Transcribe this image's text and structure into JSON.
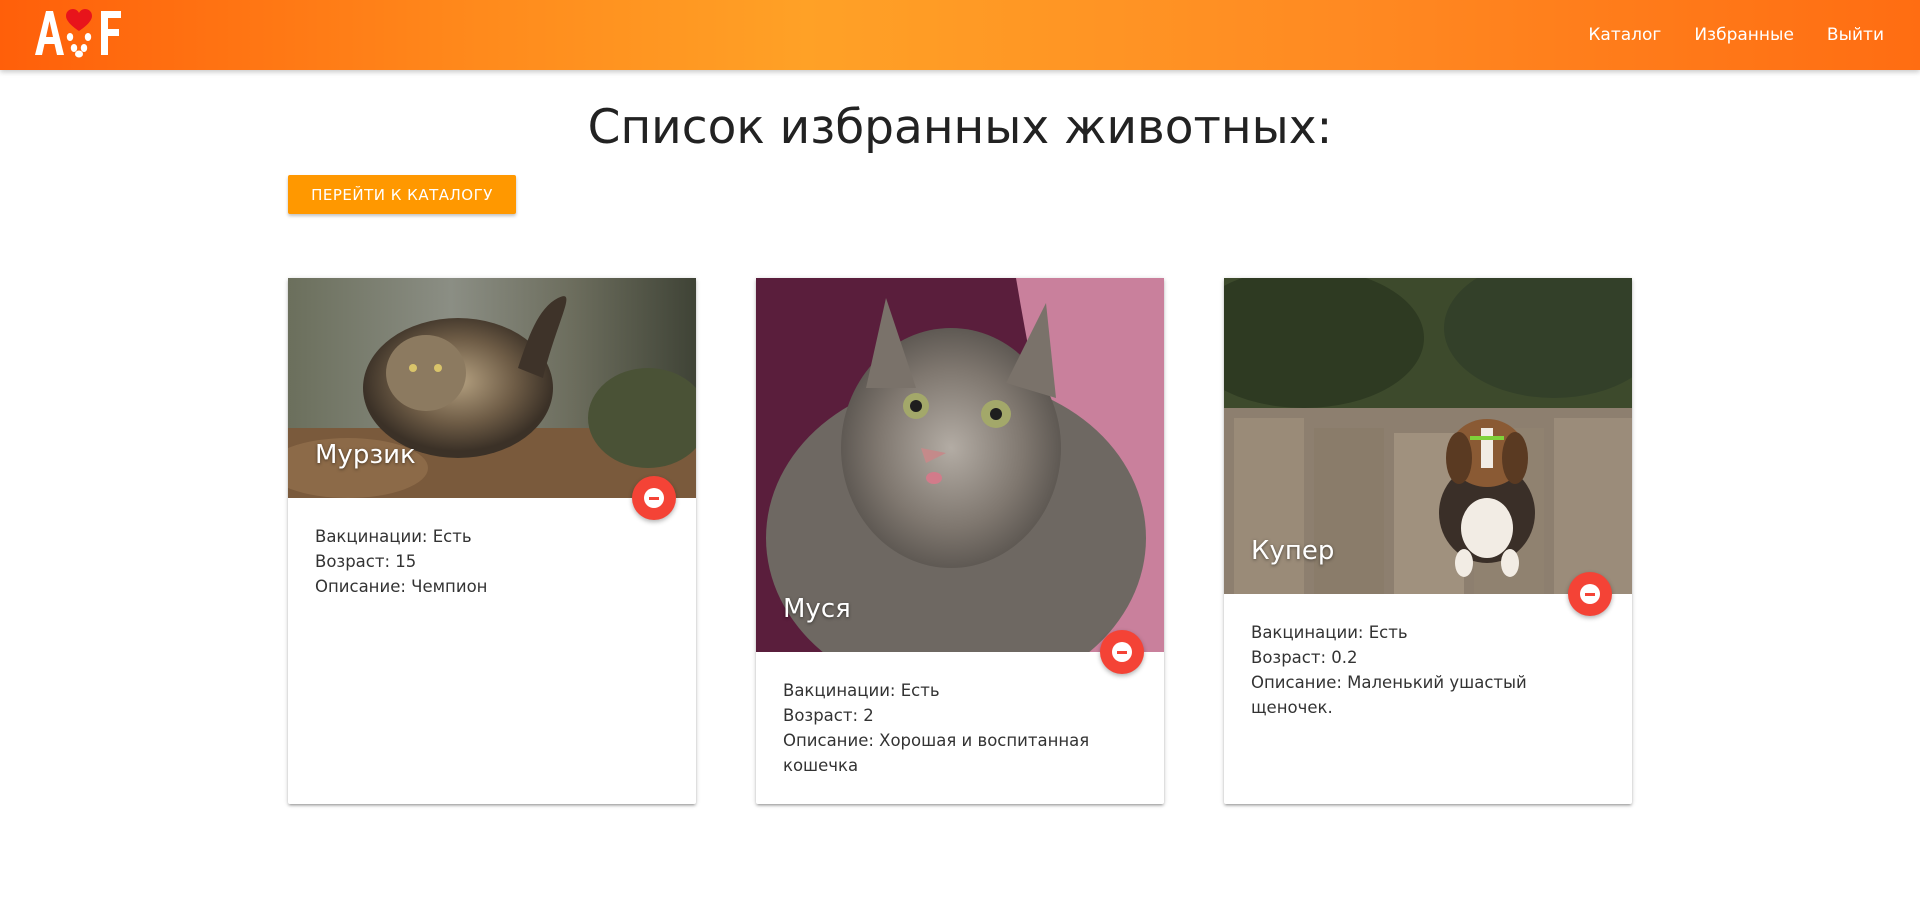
{
  "navbar": {
    "logo": "A F",
    "links": [
      "Каталог",
      "Избранные",
      "Выйти"
    ]
  },
  "page": {
    "title": "Список избранных животных:",
    "catalog_button": "Перейти к каталогу"
  },
  "cards": [
    {
      "name": "Мурзик",
      "vaccinations": "Вакцинации: Есть",
      "age": "Возраст: 15",
      "description": "Описание: Чемпион",
      "image": "long-haired tabby cat walking outdoors"
    },
    {
      "name": "Муся",
      "vaccinations": "Вакцинации: Есть",
      "age": "Возраст: 2",
      "description": "Описание: Хорошая и воспитанная кошечка",
      "image": "grey tabby cat close-up on purple background"
    },
    {
      "name": "Купер",
      "vaccinations": "Вакцинации: Есть",
      "age": "Возраст: 0.2",
      "description": "Описание: Маленький ушастый щеночек.",
      "image": "beagle puppy sitting on wooden planks"
    }
  ],
  "colors": {
    "navbar_gradient": [
      "#ff5f0a",
      "#ffa126",
      "#ff6d12"
    ],
    "accent_button": "#ff9800",
    "remove_button": "#f44336"
  },
  "icons": [
    "paw-heart-logo-icon",
    "remove-circle-icon"
  ]
}
